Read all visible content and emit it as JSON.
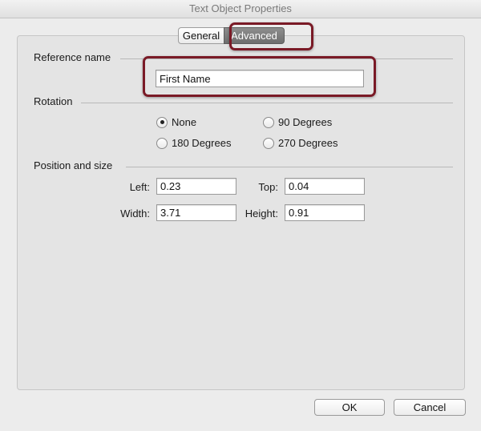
{
  "window": {
    "title": "Text Object Properties"
  },
  "tabs": [
    {
      "label": "General",
      "selected": false
    },
    {
      "label": "Advanced",
      "selected": true
    }
  ],
  "reference": {
    "section_label": "Reference name",
    "value": "First Name"
  },
  "rotation": {
    "section_label": "Rotation",
    "options": [
      {
        "label": "None",
        "selected": true
      },
      {
        "label": "90 Degrees",
        "selected": false
      },
      {
        "label": "180 Degrees",
        "selected": false
      },
      {
        "label": "270 Degrees",
        "selected": false
      }
    ]
  },
  "position": {
    "section_label": "Position and size",
    "left_label": "Left:",
    "left_value": "0.23",
    "top_label": "Top:",
    "top_value": "0.04",
    "width_label": "Width:",
    "width_value": "3.71",
    "height_label": "Height:",
    "height_value": "0.91"
  },
  "buttons": {
    "ok": "OK",
    "cancel": "Cancel"
  },
  "colors": {
    "highlight": "#7a1a26",
    "active_tab": "#7a7a7a"
  }
}
